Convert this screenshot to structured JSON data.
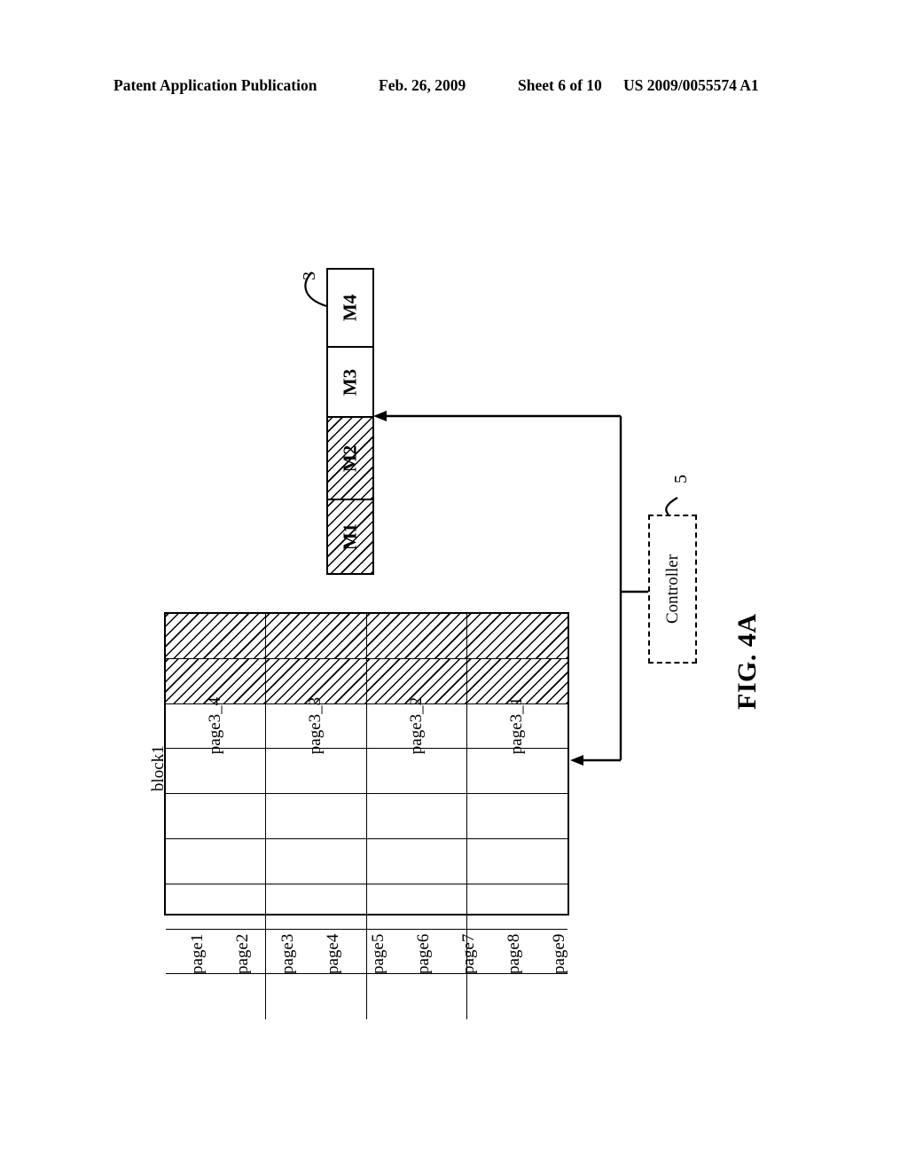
{
  "header": {
    "publication": "Patent Application Publication",
    "date": "Feb. 26, 2009",
    "sheet": "Sheet 6 of 10",
    "patent_number": "US 2009/0055574 A1"
  },
  "figure": {
    "caption": "FIG. 4A"
  },
  "memory_strip": {
    "reference_numeral": "3",
    "cells": [
      {
        "label": "M4",
        "hatched": false
      },
      {
        "label": "M3",
        "hatched": false
      },
      {
        "label": "M2",
        "hatched": true
      },
      {
        "label": "M1",
        "hatched": true
      }
    ]
  },
  "block": {
    "label": "block1",
    "pages": [
      "page1",
      "page2",
      "page3",
      "page4",
      "page5",
      "page6",
      "page7",
      "page8",
      "page9"
    ],
    "hatched_pages": [
      "page1",
      "page2"
    ],
    "subsectors": [
      "page3_1",
      "page3_2",
      "page3_3",
      "page3_4"
    ],
    "subsector_row": "page3",
    "columns": 4
  },
  "controller": {
    "label": "Controller",
    "reference_numeral": "5",
    "border_style": "dashed"
  },
  "colors": {
    "ink": "#000000",
    "paper": "#ffffff"
  }
}
